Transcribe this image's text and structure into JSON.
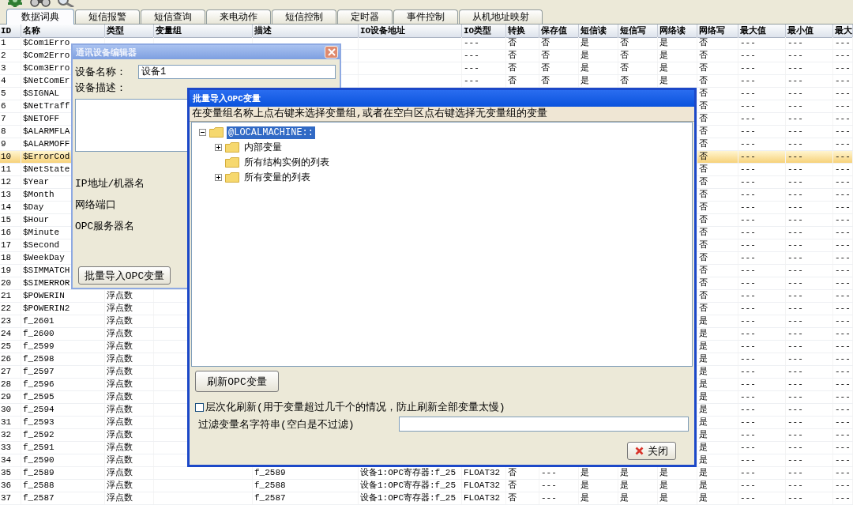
{
  "tabs": [
    {
      "label": "数据词典",
      "selected": true
    },
    {
      "label": "短信报警",
      "selected": false
    },
    {
      "label": "短信查询",
      "selected": false
    },
    {
      "label": "来电动作",
      "selected": false
    },
    {
      "label": "短信控制",
      "selected": false
    },
    {
      "label": "定时器",
      "selected": false
    },
    {
      "label": "事件控制",
      "selected": false
    },
    {
      "label": "从机地址映射",
      "selected": false
    }
  ],
  "table": {
    "columns": [
      "ID",
      "名称",
      "类型",
      "变量组",
      "描述",
      "IO设备地址",
      "IO类型",
      "转换",
      "保存值",
      "短信读",
      "短信写",
      "网络读",
      "网络写",
      "最大值",
      "最小值",
      "最大"
    ],
    "rows": [
      {
        "selected": false,
        "id": "1",
        "name": "$Com1Erro",
        "io_type": "---",
        "conversion": "否",
        "saved": "否",
        "sms_read": "是",
        "sms_write": "否",
        "net_read": "是",
        "net_write": "否",
        "max": "---",
        "min": "---",
        "column_16": "---"
      },
      {
        "selected": false,
        "id": "2",
        "name": "$Com2Erro",
        "io_type": "---",
        "conversion": "否",
        "saved": "否",
        "sms_read": "是",
        "sms_write": "否",
        "net_read": "是",
        "net_write": "否",
        "max": "---",
        "min": "---",
        "column_16": "---"
      },
      {
        "selected": false,
        "id": "3",
        "name": "$Com3Erro",
        "io_type": "---",
        "conversion": "否",
        "saved": "否",
        "sms_read": "是",
        "sms_write": "否",
        "net_read": "是",
        "net_write": "否",
        "max": "---",
        "min": "---",
        "column_16": "---"
      },
      {
        "selected": false,
        "id": "4",
        "name": "$NetComEr",
        "io_type": "---",
        "conversion": "否",
        "saved": "否",
        "sms_read": "是",
        "sms_write": "否",
        "net_read": "是",
        "net_write": "否",
        "max": "---",
        "min": "---",
        "column_16": "---"
      },
      {
        "selected": false,
        "id": "5",
        "name": "$SIGNAL",
        "net_write": "否",
        "max": "---",
        "min": "---",
        "column_16": "---"
      },
      {
        "selected": false,
        "id": "6",
        "name": "$NetTraff",
        "net_write": "否",
        "max": "---",
        "min": "---",
        "column_16": "---"
      },
      {
        "selected": false,
        "id": "7",
        "name": "$NETOFF",
        "net_write": "否",
        "max": "---",
        "min": "---",
        "column_16": "---"
      },
      {
        "selected": false,
        "id": "8",
        "name": "$ALARMFLA",
        "net_write": "否",
        "max": "---",
        "min": "---",
        "column_16": "---"
      },
      {
        "selected": false,
        "id": "9",
        "name": "$ALARMOFF",
        "net_write": "否",
        "max": "---",
        "min": "---",
        "column_16": "---"
      },
      {
        "selected": true,
        "id": "10",
        "name": "$ErrorCod",
        "net_write": "否",
        "max": "---",
        "min": "---",
        "column_16": "---"
      },
      {
        "selected": false,
        "id": "11",
        "name": "$NetState",
        "net_write": "否",
        "max": "---",
        "min": "---",
        "column_16": "---"
      },
      {
        "selected": false,
        "id": "12",
        "name": "$Year",
        "net_write": "否",
        "max": "---",
        "min": "---",
        "column_16": "---"
      },
      {
        "selected": false,
        "id": "13",
        "name": "$Month",
        "net_write": "否",
        "max": "---",
        "min": "---",
        "column_16": "---"
      },
      {
        "selected": false,
        "id": "14",
        "name": "$Day",
        "net_write": "否",
        "max": "---",
        "min": "---",
        "column_16": "---"
      },
      {
        "selected": false,
        "id": "15",
        "name": "$Hour",
        "net_write": "否",
        "max": "---",
        "min": "---",
        "column_16": "---"
      },
      {
        "selected": false,
        "id": "16",
        "name": "$Minute",
        "net_write": "否",
        "max": "---",
        "min": "---",
        "column_16": "---"
      },
      {
        "selected": false,
        "id": "17",
        "name": "$Second",
        "net_write": "否",
        "max": "---",
        "min": "---",
        "column_16": "---"
      },
      {
        "selected": false,
        "id": "18",
        "name": "$WeekDay",
        "net_write": "否",
        "max": "---",
        "min": "---",
        "column_16": "---"
      },
      {
        "selected": false,
        "id": "19",
        "name": "$SIMMATCH",
        "net_write": "否",
        "max": "---",
        "min": "---",
        "column_16": "---"
      },
      {
        "selected": false,
        "id": "20",
        "name": "$SIMERROR",
        "net_write": "否",
        "max": "---",
        "min": "---",
        "column_16": "---"
      },
      {
        "selected": false,
        "id": "21",
        "name": "$POWERIN",
        "type": "浮点数",
        "net_write": "否",
        "max": "---",
        "min": "---",
        "column_16": "---"
      },
      {
        "selected": false,
        "id": "22",
        "name": "$POWERIN2",
        "type": "浮点数",
        "net_write": "否",
        "max": "---",
        "min": "---",
        "column_16": "---"
      },
      {
        "selected": false,
        "id": "23",
        "name": "f_2601",
        "type": "浮点数",
        "net_write": "是",
        "max": "---",
        "min": "---",
        "column_16": "---"
      },
      {
        "selected": false,
        "id": "24",
        "name": "f_2600",
        "type": "浮点数",
        "net_write": "是",
        "max": "---",
        "min": "---",
        "column_16": "---"
      },
      {
        "selected": false,
        "id": "25",
        "name": "f_2599",
        "type": "浮点数",
        "net_write": "是",
        "max": "---",
        "min": "---",
        "column_16": "---"
      },
      {
        "selected": false,
        "id": "26",
        "name": "f_2598",
        "type": "浮点数",
        "net_write": "是",
        "max": "---",
        "min": "---",
        "column_16": "---"
      },
      {
        "selected": false,
        "id": "27",
        "name": "f_2597",
        "type": "浮点数",
        "net_write": "是",
        "max": "---",
        "min": "---",
        "column_16": "---"
      },
      {
        "selected": false,
        "id": "28",
        "name": "f_2596",
        "type": "浮点数",
        "net_write": "是",
        "max": "---",
        "min": "---",
        "column_16": "---"
      },
      {
        "selected": false,
        "id": "29",
        "name": "f_2595",
        "type": "浮点数",
        "net_write": "是",
        "max": "---",
        "min": "---",
        "column_16": "---"
      },
      {
        "selected": false,
        "id": "30",
        "name": "f_2594",
        "type": "浮点数",
        "net_write": "是",
        "max": "---",
        "min": "---",
        "column_16": "---"
      },
      {
        "selected": false,
        "id": "31",
        "name": "f_2593",
        "type": "浮点数",
        "net_write": "是",
        "max": "---",
        "min": "---",
        "column_16": "---"
      },
      {
        "selected": false,
        "id": "32",
        "name": "f_2592",
        "type": "浮点数",
        "net_write": "是",
        "max": "---",
        "min": "---",
        "column_16": "---"
      },
      {
        "selected": false,
        "id": "33",
        "name": "f_2591",
        "type": "浮点数",
        "net_write": "是",
        "max": "---",
        "min": "---",
        "column_16": "---"
      },
      {
        "selected": false,
        "id": "34",
        "name": "f_2590",
        "type": "浮点数",
        "net_write": "是",
        "max": "---",
        "min": "---",
        "column_16": "---"
      },
      {
        "selected": false,
        "id": "35",
        "name": "f_2589",
        "type": "浮点数",
        "description": "f_2589",
        "io_address": "设备1:OPC寄存器:f_25",
        "io_type": "FLOAT32",
        "conversion": "否",
        "saved": "---",
        "sms_read": "是",
        "sms_write": "是",
        "net_read": "是",
        "net_write": "是",
        "max": "---",
        "min": "---",
        "column_16": "---"
      },
      {
        "selected": false,
        "id": "36",
        "name": "f_2588",
        "type": "浮点数",
        "description": "f_2588",
        "io_address": "设备1:OPC寄存器:f_25",
        "io_type": "FLOAT32",
        "conversion": "否",
        "saved": "---",
        "sms_read": "是",
        "sms_write": "是",
        "net_read": "是",
        "net_write": "是",
        "max": "---",
        "min": "---",
        "column_16": "---"
      },
      {
        "selected": false,
        "id": "37",
        "name": "f_2587",
        "type": "浮点数",
        "description": "f_2587",
        "io_address": "设备1:OPC寄存器:f_25",
        "io_type": "FLOAT32",
        "conversion": "否",
        "saved": "---",
        "sms_read": "是",
        "sms_write": "是",
        "net_read": "是",
        "net_write": "是",
        "max": "---",
        "min": "---",
        "column_16": "---"
      }
    ]
  },
  "device_editor": {
    "title": "通讯设备编辑器",
    "active": false,
    "name_label": "设备名称：",
    "name_value": "设备1",
    "description_label": "设备描述：",
    "labels": [
      "IP地址/机器名",
      "网络端口",
      "OPC服务器名"
    ],
    "import_button": "批量导入OPC变量"
  },
  "opc_import": {
    "title": "批量导入OPC变量",
    "active": true,
    "instruction": "在变量组名称上点右键来选择变量组,或者在空白区点右键选择无变量组的变量",
    "tree": [
      {
        "label": "@LOCALMACHINE::",
        "selected": true,
        "expandable": true,
        "expanded": true,
        "children": [
          {
            "label": "内部变量",
            "selected": false,
            "expandable": true,
            "expanded": false
          },
          {
            "label": "所有结构实例的列表",
            "selected": false,
            "expandable": false
          },
          {
            "label": "所有变量的列表",
            "selected": false,
            "expandable": true,
            "expanded": false
          }
        ]
      }
    ],
    "refresh_button": "刷新OPC变量",
    "hierarchical_refresh": {
      "label": "层次化刷新(用于变量超过几千个的情况，防止刷新全部变量太慢)",
      "checked": false
    },
    "filter": {
      "label": "过滤变量名字符串(空白是不过滤)"
    },
    "close_button": "关闭"
  }
}
